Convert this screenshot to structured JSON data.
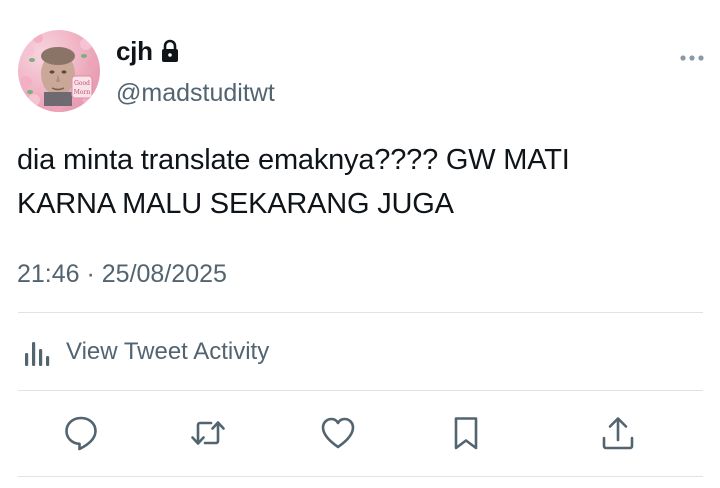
{
  "user": {
    "display_name": "cjh",
    "handle": "@madstuditwt",
    "protected_icon": "lock-icon",
    "avatar_sticker_text": [
      "Good",
      "Morn"
    ]
  },
  "tweet": {
    "text_lines": [
      "dia minta translate emaknya???? GW MATI",
      "KARNA MALU SEKARANG JUGA"
    ],
    "timestamp": "21:46 · 25/08/2025"
  },
  "activity": {
    "label": "View Tweet Activity",
    "icon": "bar-chart-icon"
  },
  "actions": [
    {
      "name": "reply",
      "icon": "reply-icon"
    },
    {
      "name": "retweet",
      "icon": "retweet-icon"
    },
    {
      "name": "like",
      "icon": "heart-icon"
    },
    {
      "name": "bookmark",
      "icon": "bookmark-icon"
    },
    {
      "name": "share",
      "icon": "share-icon"
    }
  ],
  "colors": {
    "text_primary": "#0f1419",
    "text_secondary": "#536471",
    "divider": "#dfe3e6"
  }
}
